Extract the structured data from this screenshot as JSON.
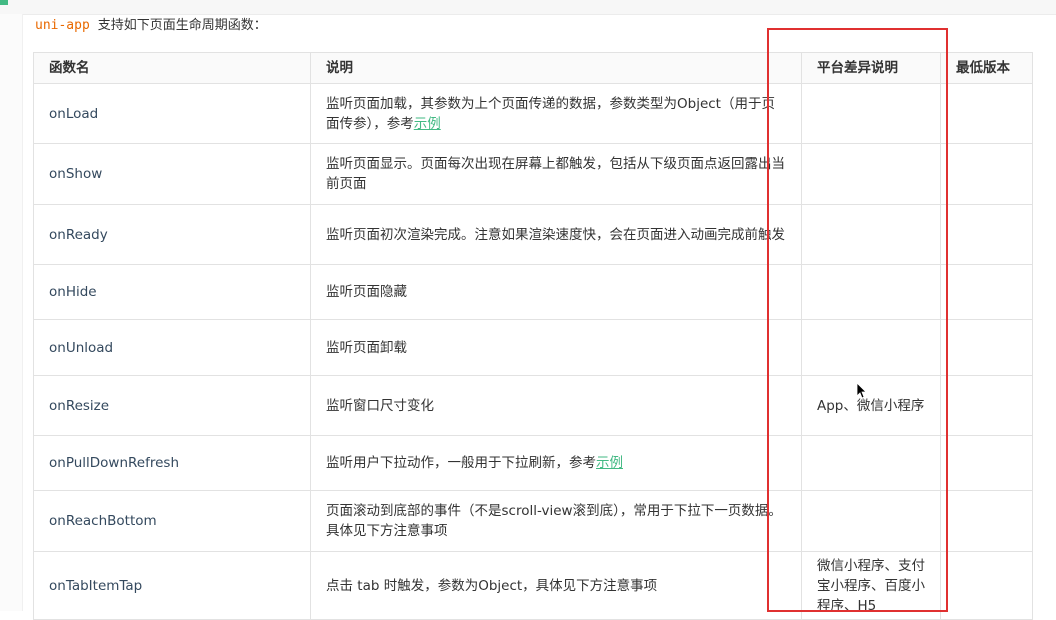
{
  "intro": {
    "code": "uni-app",
    "text": "支持如下页面生命周期函数："
  },
  "table": {
    "headers": {
      "name": "函数名",
      "desc": "说明",
      "platform": "平台差异说明",
      "version": "最低版本"
    },
    "rows": [
      {
        "name": "onLoad",
        "desc": "监听页面加载，其参数为上个页面传递的数据，参数类型为Object（用于页面传参），参考",
        "link": "示例",
        "platform": "",
        "version": ""
      },
      {
        "name": "onShow",
        "desc": "监听页面显示。页面每次出现在屏幕上都触发，包括从下级页面点返回露出当前页面",
        "link": "",
        "platform": "",
        "version": ""
      },
      {
        "name": "onReady",
        "desc": "监听页面初次渲染完成。注意如果渲染速度快，会在页面进入动画完成前触发",
        "link": "",
        "platform": "",
        "version": ""
      },
      {
        "name": "onHide",
        "desc": "监听页面隐藏",
        "link": "",
        "platform": "",
        "version": ""
      },
      {
        "name": "onUnload",
        "desc": "监听页面卸载",
        "link": "",
        "platform": "",
        "version": ""
      },
      {
        "name": "onResize",
        "desc": "监听窗口尺寸变化",
        "link": "",
        "platform": "App、微信小程序",
        "version": ""
      },
      {
        "name": "onPullDownRefresh",
        "desc": "监听用户下拉动作，一般用于下拉刷新，参考",
        "link": "示例",
        "platform": "",
        "version": ""
      },
      {
        "name": "onReachBottom",
        "desc": "页面滚动到底部的事件（不是scroll-view滚到底），常用于下拉下一页数据。具体见下方注意事项",
        "link": "",
        "platform": "",
        "version": ""
      },
      {
        "name": "onTabItemTap",
        "desc": "点击 tab 时触发，参数为Object，具体见下方注意事项",
        "link": "",
        "platform": "微信小程序、支付宝小程序、百度小程序、H5",
        "version": ""
      }
    ]
  },
  "colors": {
    "accent": "#42b983",
    "highlight_box": "#e03030",
    "code": "#e96900"
  },
  "icons": {
    "cursor": "mouse-pointer-icon"
  }
}
